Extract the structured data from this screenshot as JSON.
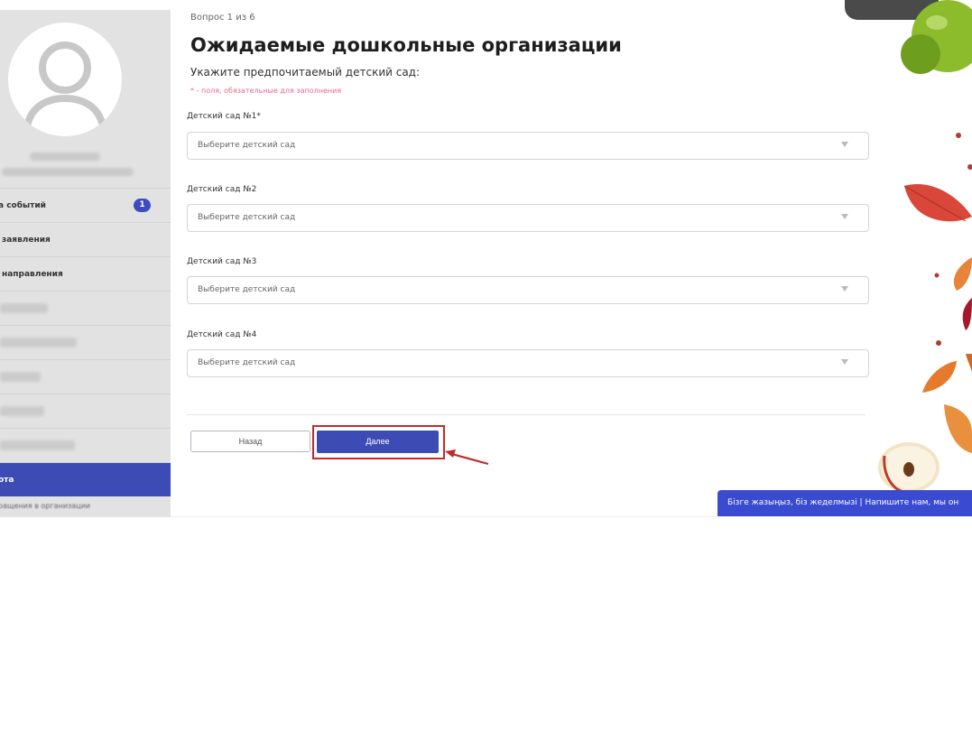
{
  "sidebar": {
    "menu": [
      {
        "label": "а событий",
        "badge": "1"
      },
      {
        "label": "заявления"
      },
      {
        "label": "направления"
      },
      {
        "label": ""
      },
      {
        "label": ""
      },
      {
        "label": ""
      },
      {
        "label": ""
      },
      {
        "label": ""
      },
      {
        "label": "ота",
        "active": true
      },
      {
        "label": "ращения в организации"
      }
    ]
  },
  "form": {
    "question_counter": "Вопрос 1 из 6",
    "title": "Ожидаемые дошкольные организации",
    "subtitle": "Укажите предпочитаемый детский сад:",
    "required_note": "* - поля, обязательные для заполнения",
    "fields": [
      {
        "label": "Детский сад №1*",
        "placeholder": "Выберите детский сад"
      },
      {
        "label": "Детский сад №2",
        "placeholder": "Выберите детский сад"
      },
      {
        "label": "Детский сад №3",
        "placeholder": "Выберите детский сад"
      },
      {
        "label": "Детский сад №4",
        "placeholder": "Выберите детский сад"
      }
    ],
    "back_label": "Назад",
    "next_label": "Далее"
  },
  "chat_banner": {
    "text": "Бізге жазыңыз, біз жеделмызі | Напишите нам, мы он"
  },
  "colors": {
    "primary": "#3d4bb5",
    "highlight": "#c32b2b",
    "required": "#e06b8b",
    "sidebar_bg": "#e2e2e2"
  }
}
